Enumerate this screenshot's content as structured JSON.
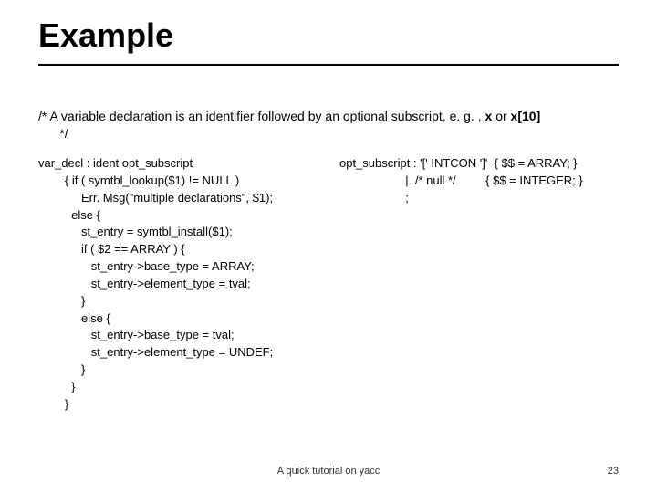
{
  "title": "Example",
  "comment_prefix": "/* A variable declaration is an identifier followed by an optional subscript, e. g. , ",
  "comment_bold1": "x",
  "comment_mid": " or ",
  "comment_bold2": "x[10]",
  "comment_suffix_line2": "*/",
  "left_code": "var_decl : ident opt_subscript\n        { if ( symtbl_lookup($1) != NULL )\n             Err. Msg(\"multiple declarations\", $1);\n          else {\n             st_entry = symtbl_install($1);\n             if ( $2 == ARRAY ) {\n                st_entry->base_type = ARRAY;\n                st_entry->element_type = tval;\n             }\n             else {\n                st_entry->base_type = tval;\n                st_entry->element_type = UNDEF;\n             }\n          }\n        }",
  "right_code": "opt_subscript : '[' INTCON ']'  { $$ = ARRAY; }\n                    |  /* null */         { $$ = INTEGER; }\n                    ;",
  "footer_title": "A quick tutorial on yacc",
  "page_number": "23"
}
